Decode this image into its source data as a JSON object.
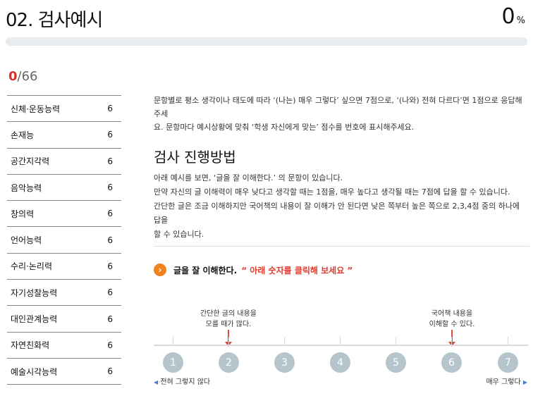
{
  "header": {
    "title": "02. 검사예시",
    "percent_value": "0",
    "percent_unit": "%",
    "progress": 0
  },
  "counter": {
    "current": "0",
    "total": "/66"
  },
  "categories": [
    {
      "name": "신체·운동능력",
      "count": "6"
    },
    {
      "name": "손재능",
      "count": "6"
    },
    {
      "name": "공간지각력",
      "count": "6"
    },
    {
      "name": "음악능력",
      "count": "6"
    },
    {
      "name": "창의력",
      "count": "6"
    },
    {
      "name": "언어능력",
      "count": "6"
    },
    {
      "name": "수리·논리력",
      "count": "6"
    },
    {
      "name": "자기성찰능력",
      "count": "6"
    },
    {
      "name": "대인관계능력",
      "count": "6"
    },
    {
      "name": "자연친화력",
      "count": "6"
    },
    {
      "name": "예술시각능력",
      "count": "6"
    }
  ],
  "intro": {
    "line1": "문항별로 평소 생각이나 태도에 따라 ‘(나는) 매우 그렇다’ 싶으면 7점으로, ‘(나와) 전혀 다르다’면 1점으로 응답해주세",
    "line2": "요. 문항마다 예시상황에 맞춰 ‘학생 자신에게 맞는’ 점수를 번호에 표시해주세요."
  },
  "method": {
    "title": "검사 진행방법",
    "line1": "아래 예시를 보면, ‘글을 잘 이해한다.’ 의 문항이 있습니다.",
    "line2": "만약 자신의 글 이해력이 매우 낮다고 생각할 때는 1점을, 매우 높다고 생각될 때는 7점에 답을 할 수 있습니다.",
    "line3": "간단한 글은 조금 이해하지만 국어책의 내용이 잘 이해가 안 된다면 낮은 쪽부터 높은 쪽으로 2,3,4점 중의 하나에 답을",
    "line4": "할 수 있습니다."
  },
  "question": {
    "icon": "chevron-right-icon",
    "text": "글을 잘 이해한다.",
    "hint": "“ 아래 숫자를 클릭해 보세요 ”"
  },
  "notes": {
    "low_line1": "간단한 글의 내용을",
    "low_line2": "모를 때가 많다.",
    "high_line1": "국어책 내용을",
    "high_line2": "이해할 수 있다."
  },
  "scale": {
    "options": [
      "1",
      "2",
      "3",
      "4",
      "5",
      "6",
      "7"
    ],
    "left_label": "전혀 그렇지 않다",
    "right_label": "매우 그렇다",
    "left_icon": "triangle-left-icon",
    "right_icon": "triangle-right-icon"
  },
  "colors": {
    "accent_red": "#d8302a",
    "accent_orange": "#f0831e",
    "scale_button": "#b6c4cc",
    "scale_direction": "#4a7fc1"
  }
}
